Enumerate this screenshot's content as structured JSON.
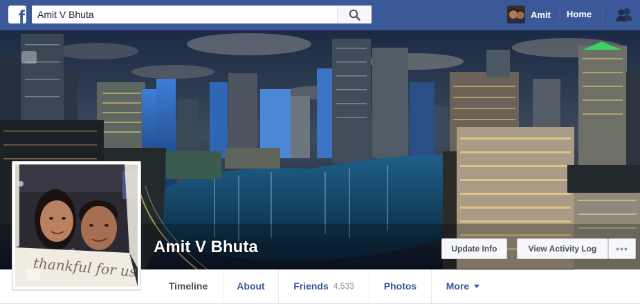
{
  "topbar": {
    "logo_letter": "f",
    "search_value": "Amit V Bhuta",
    "user_name": "Amit",
    "home_label": "Home",
    "brand_color": "#3b5998"
  },
  "profile": {
    "name": "Amit V Bhuta",
    "photo_caption": "thankful for us"
  },
  "actions": {
    "update_info": "Update Info",
    "view_activity_log": "View Activity Log",
    "more": "•••"
  },
  "tabs": {
    "timeline": "Timeline",
    "about": "About",
    "friends": "Friends",
    "friends_count": "4,533",
    "photos": "Photos",
    "more": "More"
  }
}
